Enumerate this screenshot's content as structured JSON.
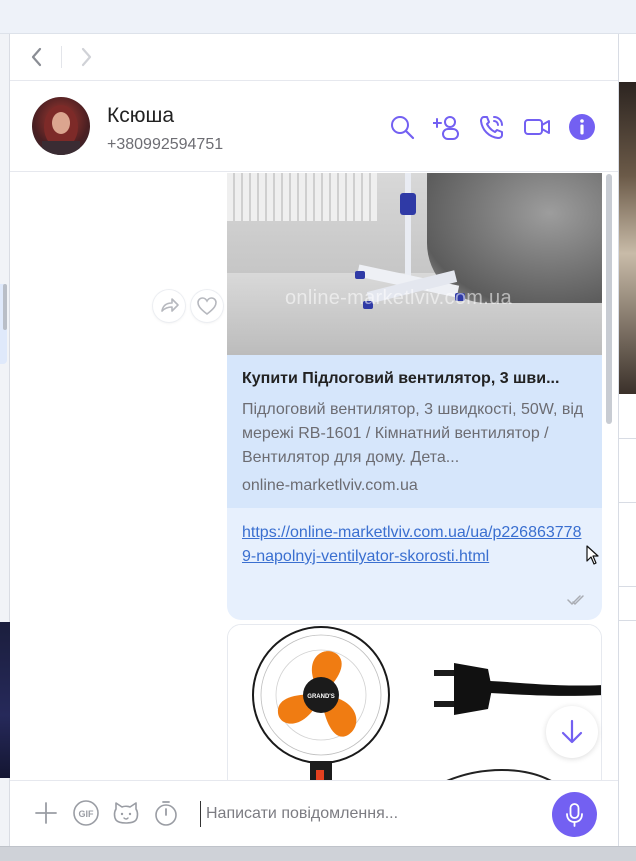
{
  "navigation": {
    "back": "back",
    "forward": "forward"
  },
  "contact": {
    "name": "Ксюша",
    "phone": "+380992594751"
  },
  "header_actions": [
    {
      "name": "search-icon"
    },
    {
      "name": "add-participant-icon"
    },
    {
      "name": "voice-call-icon"
    },
    {
      "name": "video-call-icon"
    },
    {
      "name": "info-icon"
    }
  ],
  "message": {
    "preview_watermark": "online-marketlviv.com.ua",
    "link_title": "Купити Підлоговий вентилятор, 3 шви...",
    "link_description": "Підлоговий вентилятор, 3 швидкості, 50W, від мережі RB-1601 / Кімнатний вентилятор / Вентилятор для дому. Дета...",
    "link_domain": "online-marketlviv.com.ua",
    "link_url": "https://online-marketlviv.com.ua/ua/p2268637789-napolnyj-ventilyator-skorosti.html",
    "link_url_display": "https://online-marketlviv.com.ua/ua/p2268637789-napolnyj-ventilyator-skorosti.html"
  },
  "second_message": {
    "fan_brand_label": "GRAND'S"
  },
  "composer": {
    "placeholder": "Написати повідомлення..."
  },
  "colors": {
    "accent": "#7360f2",
    "bubble_bg": "#e7f0fd",
    "link_meta_bg": "#d6e6fb",
    "link": "#3a6fd0"
  }
}
